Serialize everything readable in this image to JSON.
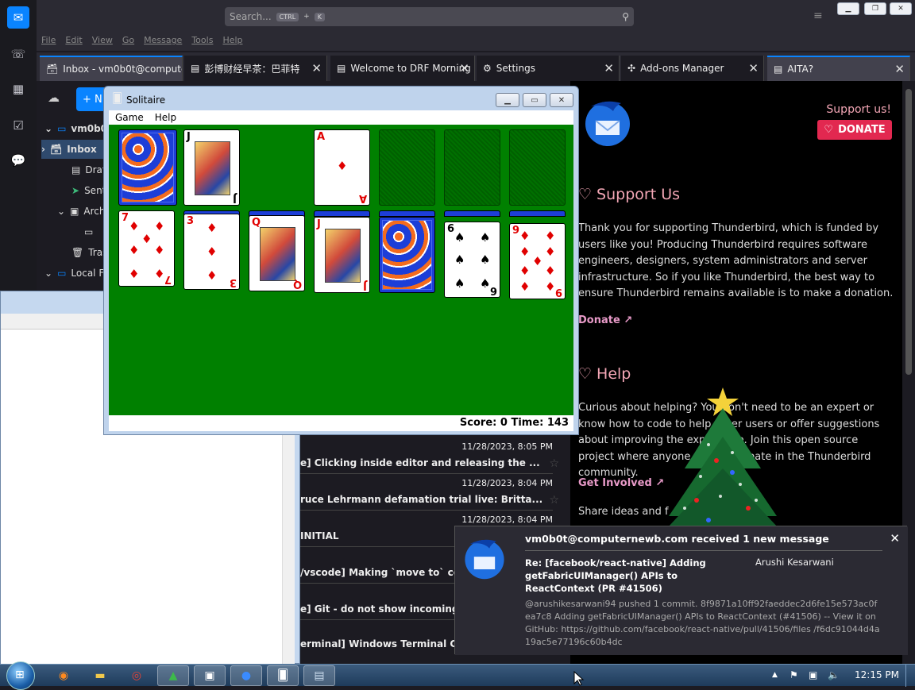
{
  "thunderbird": {
    "search_placeholder": "Search...",
    "search_kbd1": "CTRL",
    "search_plus": "+",
    "search_kbd2": "K",
    "menu": [
      "File",
      "Edit",
      "View",
      "Go",
      "Message",
      "Tools",
      "Help"
    ],
    "tabs": [
      {
        "label": "Inbox - vm0b0t@computernewb.com",
        "icon": "inbox-icon"
      },
      {
        "label": "彭博财经早茶：巴菲特",
        "icon": "doc-icon"
      },
      {
        "label": "Welcome to DRF Morning",
        "icon": "doc-icon"
      },
      {
        "label": "Settings",
        "icon": "gear-icon"
      },
      {
        "label": "Add-ons Manager",
        "icon": "puzzle-icon"
      },
      {
        "label": "AITA?",
        "icon": "doc-icon"
      }
    ],
    "new_button": "+ N",
    "folders": [
      {
        "label": "vm0b0t",
        "kind": "account"
      },
      {
        "label": "Inbox",
        "kind": "inbox"
      },
      {
        "label": "Drafts",
        "kind": "drafts"
      },
      {
        "label": "Sent",
        "kind": "sent"
      },
      {
        "label": "Archives",
        "kind": "archive"
      },
      {
        "label": "",
        "kind": "folder"
      },
      {
        "label": "Trash",
        "kind": "trash"
      },
      {
        "label": "Local Folders",
        "kind": "local"
      }
    ],
    "messages": [
      {
        "date": "11/28/2023, 8:05 PM",
        "subject": "e] Clicking inside editor and releasing the ..."
      },
      {
        "date": "11/28/2023, 8:04 PM",
        "subject": "ruce Lehrmann defamation trial live: Britta..."
      },
      {
        "date": "11/28/2023, 8:04 PM",
        "subject": "INITIAL"
      },
      {
        "date": "",
        "subject": "/vscode] Making `move to` code"
      },
      {
        "date": "",
        "subject": "e] Git - do not show incoming/o"
      },
      {
        "date": "",
        "subject": "erminal] Windows Terminal Cras"
      }
    ]
  },
  "donate_page": {
    "support_link": "Support us!",
    "donate_button": "DONATE",
    "support_heading": "Support Us",
    "support_text": "Thank you for supporting Thunderbird, which is funded by users like you! Producing Thunderbird requires software engineers, designers, system administrators and server infrastructure. So if you like Thunderbird, the best way to ensure Thunderbird remains available is to make a donation.",
    "donate_link": "Donate",
    "help_heading": "Help",
    "help_text": "Curious about helping? You don't need to be an expert or know how to code to help other users or offer suggestions about improving the experience. Join this open source project where anyone can participate in the Thunderbird community.",
    "get_involved": "Get Involved",
    "share_text": "Share ideas and f"
  },
  "solitaire": {
    "title": "Solitaire",
    "menu": [
      "Game",
      "Help"
    ],
    "score_text": "Score: 0 Time: 143",
    "foundation_ace": "A",
    "tableau": [
      {
        "rank": "7",
        "suit": "♦",
        "color": "red"
      },
      {
        "rank": "3",
        "suit": "♦",
        "color": "red"
      },
      {
        "rank": "Q",
        "suit": "♥",
        "color": "red"
      },
      {
        "rank": "J",
        "suit": "♥",
        "color": "red"
      },
      {
        "rank": "",
        "suit": "",
        "color": "back"
      },
      {
        "rank": "6",
        "suit": "♠",
        "color": "black"
      },
      {
        "rank": "9",
        "suit": "♦",
        "color": "red"
      }
    ],
    "waste_card": {
      "rank": "J",
      "suit": "♣",
      "color": "black"
    }
  },
  "notification": {
    "title": "vm0b0t@computernewb.com received 1 new message",
    "subject": "Re: [facebook/react-native] Adding getFabricUIManager() APIs to ReactContext (PR #41506)",
    "sender": "Arushi Kesarwani",
    "preview": "@arushikesarwani94 pushed 1 commit. 8f9871a10ff92faeddec2d6fe15e573ac0fea7c8 Adding getFabricUIManager() APIs to ReactContext (#41506) -- View it on GitHub: https://github.com/facebook/react-native/pull/41506/files /f6dc91044d4a19ac5e77196c60b4dc"
  },
  "taskbar": {
    "clock": "12:15 PM",
    "apps": [
      "firefox-icon",
      "explorer-icon",
      "chrome-icon",
      "tree-icon",
      "network-icon",
      "thunderbird-icon",
      "solitaire-icon",
      "notepad-icon"
    ]
  },
  "colors": {
    "accent": "#0a84ff",
    "donate_red": "#e22850",
    "felt": "#008000"
  }
}
